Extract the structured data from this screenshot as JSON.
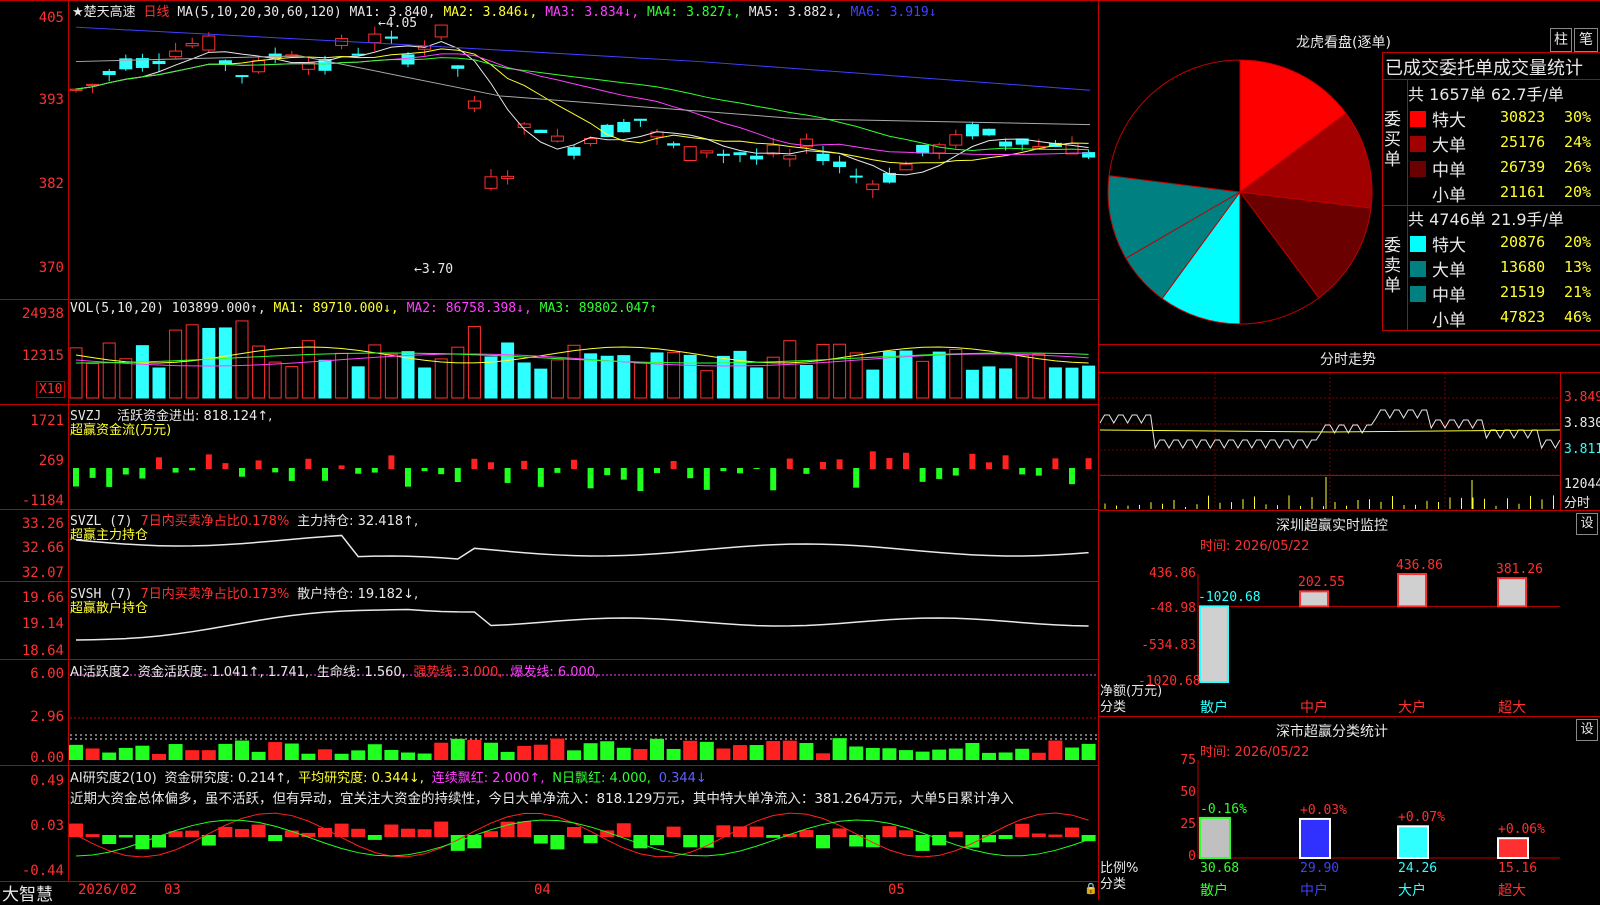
{
  "main": {
    "stock_name": "★楚天高速",
    "period": "日线",
    "ma_label": "MA(5,10,20,30,60,120)",
    "ma_values": [
      {
        "text": "MA1: 3.840,",
        "color": "#e8e8e8"
      },
      {
        "text": "MA2: 3.846↓,",
        "color": "#ffff30"
      },
      {
        "text": "MA3: 3.834↓,",
        "color": "#ff40ff"
      },
      {
        "text": "MA4: 3.827↓,",
        "color": "#30ff30"
      },
      {
        "text": "MA5: 3.882↓,",
        "color": "#e8e8e8"
      },
      {
        "text": "MA6: 3.919↓",
        "color": "#4040ff"
      }
    ],
    "y_ticks": [
      "405",
      "393",
      "382",
      "370"
    ],
    "high_label": "4.05",
    "low_label": "3.70"
  },
  "vol": {
    "label": "VOL(5,10,20)",
    "value": "103899.000↑,",
    "ma1": "MA1: 89710.000↓,",
    "ma2": "MA2: 86758.398↓,",
    "ma3": "MA3: 89802.047↑",
    "y_ticks": [
      "24938",
      "12315"
    ],
    "unit": "X10"
  },
  "svzj": {
    "label": "SVZJ",
    "desc": "活跃资金进出: 818.124↑,",
    "sub": "超赢资金流(万元)",
    "y_ticks": [
      "1721",
      "269",
      "-1184"
    ]
  },
  "svzl": {
    "label": "SVZL (7)",
    "desc": "7日内买卖净占比0.178%",
    "hold": "主力持仓: 32.418↑,",
    "sub": "超赢主力持仓",
    "y_ticks": [
      "33.26",
      "32.66",
      "32.07"
    ]
  },
  "svsh": {
    "label": "SVSH (7)",
    "desc": "7日内买卖净占比0.173%",
    "hold": "散户持仓: 19.182↓,",
    "sub": "超赢散户持仓",
    "y_ticks": [
      "19.66",
      "19.14",
      "18.64"
    ]
  },
  "ai1": {
    "label": "AI活跃度2",
    "v1": "资金活跃度: 1.041↑, 1.741,",
    "v2": "生命线: 1.560,",
    "v3": "强势线: 3.000,",
    "v4": "爆发线: 6.000,",
    "y_ticks": [
      "6.00",
      "2.96",
      "0.00"
    ]
  },
  "ai2": {
    "label": "AI研究度2(10)",
    "v1": "资金研究度: 0.214↑,",
    "v2": "平均研究度: 0.344↓,",
    "v3": "连续飘红: 2.000↑,",
    "v4": "N日飘红: 4.000,",
    "v5": "0.344↓",
    "summary": "近期大资金总体偏多，虽不活跃，但有异动，宜关注大资金的持续性，今日大单净流入：818.129万元，其中特大单净流入：381.264万元，大单5日累计净入",
    "y_ticks": [
      "0.49",
      "0.03",
      "-0.44"
    ]
  },
  "bottom": {
    "brand": "大智慧",
    "dates": [
      "2026/02",
      "03",
      "04",
      "05"
    ]
  },
  "pie_panel": {
    "title": "龙虎看盘(逐单)",
    "btn1": "柱",
    "btn2": "笔",
    "header": "已成交委托单成交量统计",
    "buy_total": "共 1657单 62.7手/单",
    "buy_label": "委买单",
    "buy_rows": [
      {
        "name": "特大",
        "value": "30823",
        "pct": "30%",
        "color": "#ff0000"
      },
      {
        "name": "大单",
        "value": "25176",
        "pct": "24%",
        "color": "#a00000"
      },
      {
        "name": "中单",
        "value": "26739",
        "pct": "26%",
        "color": "#6a0000"
      },
      {
        "name": "小单",
        "value": "21161",
        "pct": "20%",
        "color": "#000000"
      }
    ],
    "sell_total": "共 4746单 21.9手/单",
    "sell_label": "委卖单",
    "sell_rows": [
      {
        "name": "特大",
        "value": "20876",
        "pct": "20%",
        "color": "#00ffff"
      },
      {
        "name": "大单",
        "value": "13680",
        "pct": "13%",
        "color": "#008080"
      },
      {
        "name": "中单",
        "value": "21519",
        "pct": "21%",
        "color": "#008080"
      },
      {
        "name": "小单",
        "value": "47823",
        "pct": "46%",
        "color": "#000000"
      }
    ]
  },
  "intraday": {
    "title": "分时走势",
    "prices": [
      "3.849",
      "3.830",
      "3.811"
    ],
    "vol": "12044",
    "vol_unit": "分时"
  },
  "monitor": {
    "title": "深圳超赢实时监控",
    "btn": "设",
    "time": "时间: 2026/05/22",
    "y_ticks": [
      "436.86",
      "-48.98",
      "-534.83",
      "-1020.68"
    ],
    "bars": [
      {
        "name": "散户",
        "value": "-1020.68",
        "num": -1020.68
      },
      {
        "name": "中户",
        "value": "202.55",
        "num": 202.55
      },
      {
        "name": "大户",
        "value": "436.86",
        "num": 436.86
      },
      {
        "name": "超大",
        "value": "381.26",
        "num": 381.26
      }
    ],
    "axis_label1": "净额(万元)",
    "axis_label2": "分类"
  },
  "classify": {
    "title": "深市超赢分类统计",
    "btn": "设",
    "time": "时间: 2026/05/22",
    "y_ticks": [
      "75",
      "50",
      "25",
      "0"
    ],
    "bars": [
      {
        "name": "散户",
        "value": "30.68",
        "delta": "-0.16%",
        "num": 30.68
      },
      {
        "name": "中户",
        "value": "29.90",
        "delta": "+0.03%",
        "num": 29.9
      },
      {
        "name": "大户",
        "value": "24.26",
        "delta": "+0.07%",
        "num": 24.26
      },
      {
        "name": "超大",
        "value": "15.16",
        "delta": "+0.06%",
        "num": 15.16
      }
    ],
    "axis_label1": "比例%",
    "axis_label2": "分类"
  }
}
